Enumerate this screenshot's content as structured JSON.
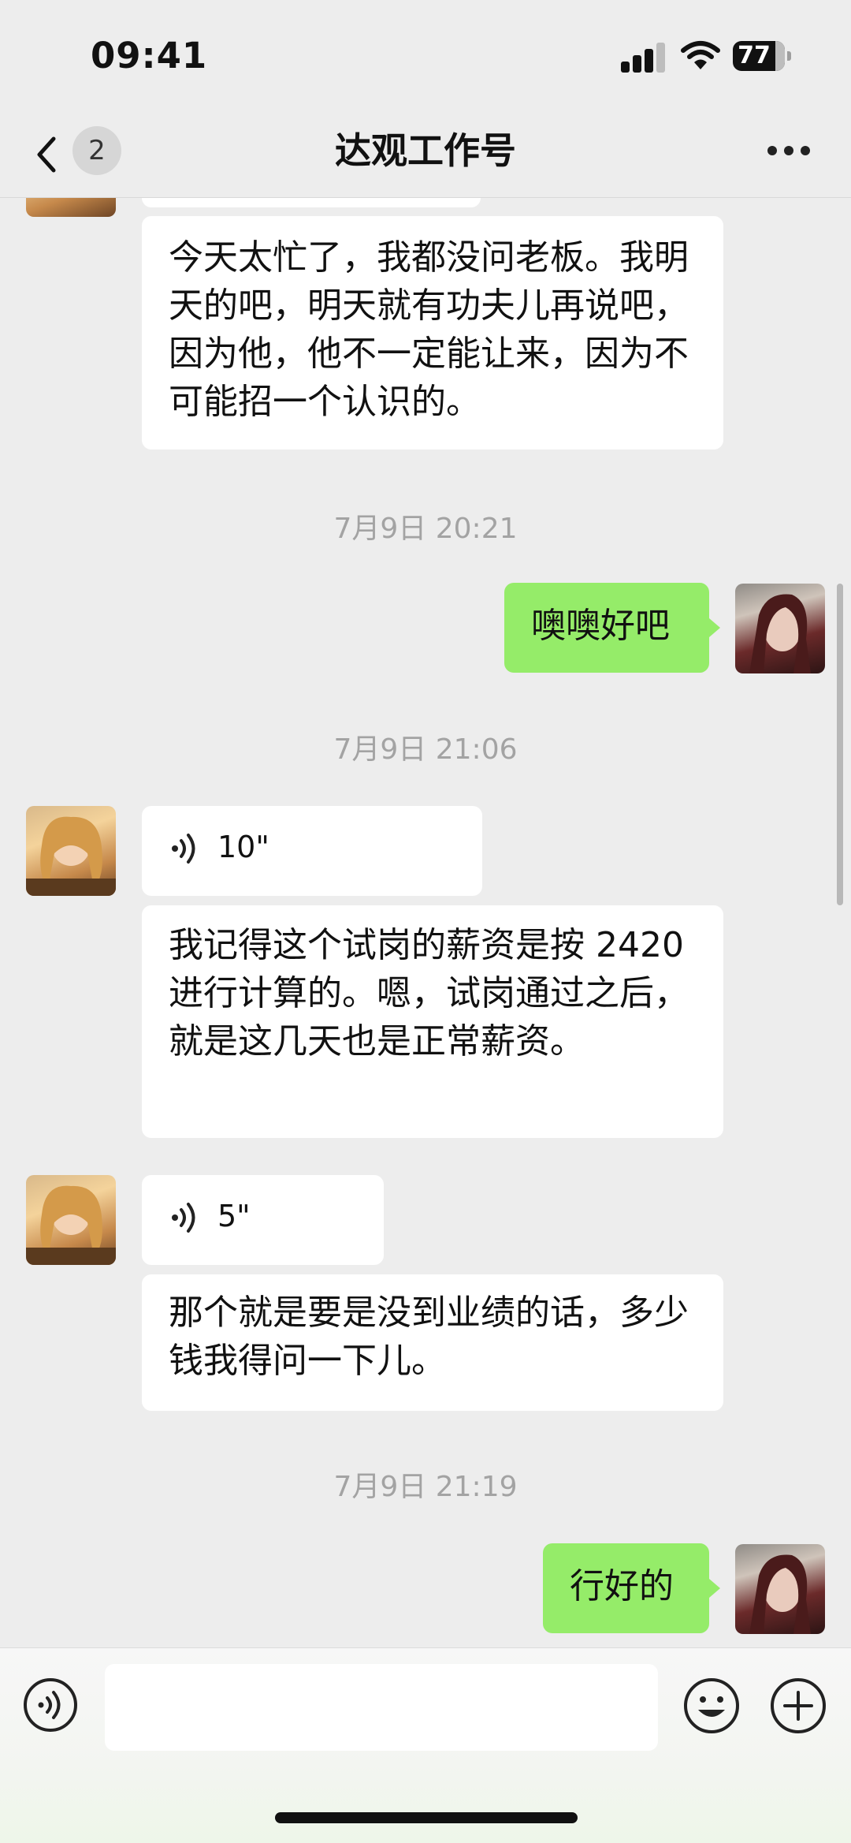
{
  "status_bar": {
    "time": "09:41",
    "battery": "77",
    "icons": [
      "signal-icon",
      "wifi-icon",
      "battery-icon"
    ]
  },
  "nav": {
    "unread_count": "2",
    "title": "达观工作号",
    "icons": [
      "chevron-left-icon",
      "more-icon"
    ]
  },
  "messages": {
    "m1": {
      "text": "今天太忙了，我都没问老板。我明天的吧，明天就有功夫儿再说吧，因为他，他不一定能让来，因为不可能招一个认识的。"
    },
    "t1": "7月9日 20:21",
    "m2": {
      "text": "噢噢好吧"
    },
    "t2": "7月9日 21:06",
    "m3": {
      "duration": "10\""
    },
    "m4": {
      "text": "我记得这个试岗的薪资是按 2420 进行计算的。嗯，试岗通过之后，就是这几天也是正常薪资。"
    },
    "m5": {
      "duration": "5\""
    },
    "m6": {
      "text": "那个就是要是没到业绩的话，多少钱我得问一下儿。"
    },
    "t3": "7月9日 21:19",
    "m7": {
      "text": "行好的"
    }
  },
  "input_bar": {
    "value": "",
    "icons": [
      "voice-input-icon",
      "emoji-icon",
      "plus-icon"
    ]
  },
  "colors": {
    "background": "#ededed",
    "outgoing_bubble": "#95ec69",
    "incoming_bubble": "#ffffff",
    "timestamp": "#a3a3a3"
  }
}
